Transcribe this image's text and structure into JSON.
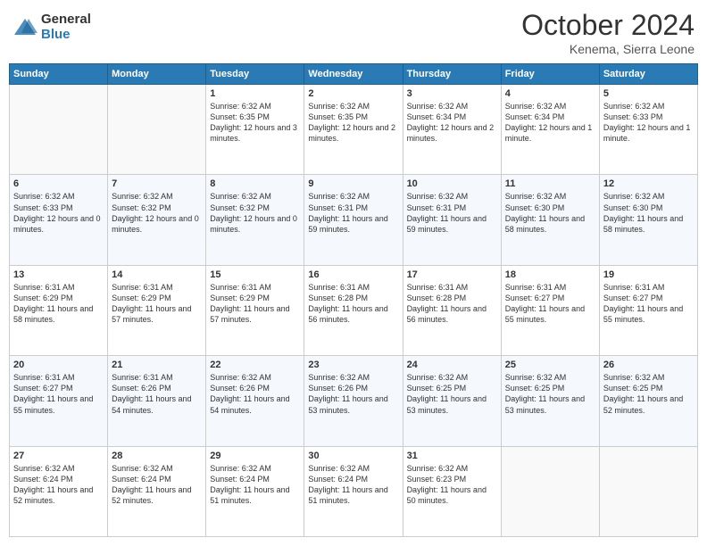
{
  "header": {
    "logo": {
      "general": "General",
      "blue": "Blue"
    },
    "month": "October 2024",
    "location": "Kenema, Sierra Leone"
  },
  "weekdays": [
    "Sunday",
    "Monday",
    "Tuesday",
    "Wednesday",
    "Thursday",
    "Friday",
    "Saturday"
  ],
  "rows": [
    [
      {
        "day": "",
        "sunrise": "",
        "sunset": "",
        "daylight": ""
      },
      {
        "day": "",
        "sunrise": "",
        "sunset": "",
        "daylight": ""
      },
      {
        "day": "1",
        "sunrise": "Sunrise: 6:32 AM",
        "sunset": "Sunset: 6:35 PM",
        "daylight": "Daylight: 12 hours and 3 minutes."
      },
      {
        "day": "2",
        "sunrise": "Sunrise: 6:32 AM",
        "sunset": "Sunset: 6:35 PM",
        "daylight": "Daylight: 12 hours and 2 minutes."
      },
      {
        "day": "3",
        "sunrise": "Sunrise: 6:32 AM",
        "sunset": "Sunset: 6:34 PM",
        "daylight": "Daylight: 12 hours and 2 minutes."
      },
      {
        "day": "4",
        "sunrise": "Sunrise: 6:32 AM",
        "sunset": "Sunset: 6:34 PM",
        "daylight": "Daylight: 12 hours and 1 minute."
      },
      {
        "day": "5",
        "sunrise": "Sunrise: 6:32 AM",
        "sunset": "Sunset: 6:33 PM",
        "daylight": "Daylight: 12 hours and 1 minute."
      }
    ],
    [
      {
        "day": "6",
        "sunrise": "Sunrise: 6:32 AM",
        "sunset": "Sunset: 6:33 PM",
        "daylight": "Daylight: 12 hours and 0 minutes."
      },
      {
        "day": "7",
        "sunrise": "Sunrise: 6:32 AM",
        "sunset": "Sunset: 6:32 PM",
        "daylight": "Daylight: 12 hours and 0 minutes."
      },
      {
        "day": "8",
        "sunrise": "Sunrise: 6:32 AM",
        "sunset": "Sunset: 6:32 PM",
        "daylight": "Daylight: 12 hours and 0 minutes."
      },
      {
        "day": "9",
        "sunrise": "Sunrise: 6:32 AM",
        "sunset": "Sunset: 6:31 PM",
        "daylight": "Daylight: 11 hours and 59 minutes."
      },
      {
        "day": "10",
        "sunrise": "Sunrise: 6:32 AM",
        "sunset": "Sunset: 6:31 PM",
        "daylight": "Daylight: 11 hours and 59 minutes."
      },
      {
        "day": "11",
        "sunrise": "Sunrise: 6:32 AM",
        "sunset": "Sunset: 6:30 PM",
        "daylight": "Daylight: 11 hours and 58 minutes."
      },
      {
        "day": "12",
        "sunrise": "Sunrise: 6:32 AM",
        "sunset": "Sunset: 6:30 PM",
        "daylight": "Daylight: 11 hours and 58 minutes."
      }
    ],
    [
      {
        "day": "13",
        "sunrise": "Sunrise: 6:31 AM",
        "sunset": "Sunset: 6:29 PM",
        "daylight": "Daylight: 11 hours and 58 minutes."
      },
      {
        "day": "14",
        "sunrise": "Sunrise: 6:31 AM",
        "sunset": "Sunset: 6:29 PM",
        "daylight": "Daylight: 11 hours and 57 minutes."
      },
      {
        "day": "15",
        "sunrise": "Sunrise: 6:31 AM",
        "sunset": "Sunset: 6:29 PM",
        "daylight": "Daylight: 11 hours and 57 minutes."
      },
      {
        "day": "16",
        "sunrise": "Sunrise: 6:31 AM",
        "sunset": "Sunset: 6:28 PM",
        "daylight": "Daylight: 11 hours and 56 minutes."
      },
      {
        "day": "17",
        "sunrise": "Sunrise: 6:31 AM",
        "sunset": "Sunset: 6:28 PM",
        "daylight": "Daylight: 11 hours and 56 minutes."
      },
      {
        "day": "18",
        "sunrise": "Sunrise: 6:31 AM",
        "sunset": "Sunset: 6:27 PM",
        "daylight": "Daylight: 11 hours and 55 minutes."
      },
      {
        "day": "19",
        "sunrise": "Sunrise: 6:31 AM",
        "sunset": "Sunset: 6:27 PM",
        "daylight": "Daylight: 11 hours and 55 minutes."
      }
    ],
    [
      {
        "day": "20",
        "sunrise": "Sunrise: 6:31 AM",
        "sunset": "Sunset: 6:27 PM",
        "daylight": "Daylight: 11 hours and 55 minutes."
      },
      {
        "day": "21",
        "sunrise": "Sunrise: 6:31 AM",
        "sunset": "Sunset: 6:26 PM",
        "daylight": "Daylight: 11 hours and 54 minutes."
      },
      {
        "day": "22",
        "sunrise": "Sunrise: 6:32 AM",
        "sunset": "Sunset: 6:26 PM",
        "daylight": "Daylight: 11 hours and 54 minutes."
      },
      {
        "day": "23",
        "sunrise": "Sunrise: 6:32 AM",
        "sunset": "Sunset: 6:26 PM",
        "daylight": "Daylight: 11 hours and 53 minutes."
      },
      {
        "day": "24",
        "sunrise": "Sunrise: 6:32 AM",
        "sunset": "Sunset: 6:25 PM",
        "daylight": "Daylight: 11 hours and 53 minutes."
      },
      {
        "day": "25",
        "sunrise": "Sunrise: 6:32 AM",
        "sunset": "Sunset: 6:25 PM",
        "daylight": "Daylight: 11 hours and 53 minutes."
      },
      {
        "day": "26",
        "sunrise": "Sunrise: 6:32 AM",
        "sunset": "Sunset: 6:25 PM",
        "daylight": "Daylight: 11 hours and 52 minutes."
      }
    ],
    [
      {
        "day": "27",
        "sunrise": "Sunrise: 6:32 AM",
        "sunset": "Sunset: 6:24 PM",
        "daylight": "Daylight: 11 hours and 52 minutes."
      },
      {
        "day": "28",
        "sunrise": "Sunrise: 6:32 AM",
        "sunset": "Sunset: 6:24 PM",
        "daylight": "Daylight: 11 hours and 52 minutes."
      },
      {
        "day": "29",
        "sunrise": "Sunrise: 6:32 AM",
        "sunset": "Sunset: 6:24 PM",
        "daylight": "Daylight: 11 hours and 51 minutes."
      },
      {
        "day": "30",
        "sunrise": "Sunrise: 6:32 AM",
        "sunset": "Sunset: 6:24 PM",
        "daylight": "Daylight: 11 hours and 51 minutes."
      },
      {
        "day": "31",
        "sunrise": "Sunrise: 6:32 AM",
        "sunset": "Sunset: 6:23 PM",
        "daylight": "Daylight: 11 hours and 50 minutes."
      },
      {
        "day": "",
        "sunrise": "",
        "sunset": "",
        "daylight": ""
      },
      {
        "day": "",
        "sunrise": "",
        "sunset": "",
        "daylight": ""
      }
    ]
  ]
}
